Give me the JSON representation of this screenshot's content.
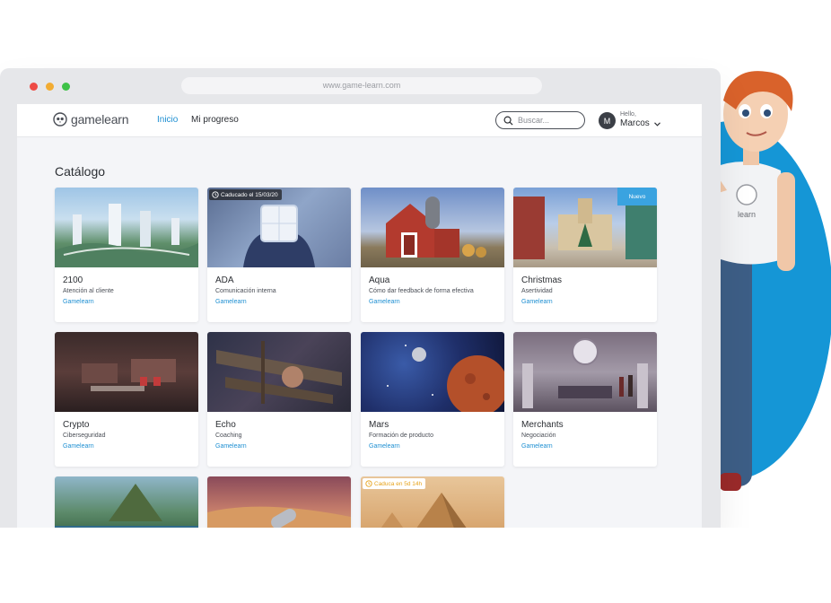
{
  "browser": {
    "url": "www.game-learn.com",
    "colors": {
      "close": "#ee4b45",
      "minimize": "#f2ac33",
      "maximize": "#3ec248"
    }
  },
  "header": {
    "logo_text": "gamelearn",
    "nav": [
      {
        "label": "Inicio",
        "active": true
      },
      {
        "label": "Mi progreso",
        "active": false
      }
    ],
    "search_placeholder": "Buscar...",
    "user": {
      "avatar_initial": "M",
      "greeting": "Hello,",
      "name": "Marcos"
    }
  },
  "catalog": {
    "title": "Catálogo",
    "courses": [
      {
        "title": "2100",
        "subtitle": "Atención al cliente",
        "author": "Gamelearn",
        "thumb": "futuristic-city",
        "badge": null
      },
      {
        "title": "ADA",
        "subtitle": "Comunicación interna",
        "author": "Gamelearn",
        "thumb": "glowing-cube-hands",
        "badge": {
          "type": "expired",
          "text": "Caducado el 15/03/20"
        }
      },
      {
        "title": "Aqua",
        "subtitle": "Cómo dar feedback de forma efectiva",
        "author": "Gamelearn",
        "thumb": "red-barn",
        "badge": null
      },
      {
        "title": "Christmas",
        "subtitle": "Asertividad",
        "author": "Gamelearn",
        "thumb": "christmas-square",
        "badge": {
          "type": "new",
          "text": "Nuevo"
        }
      },
      {
        "title": "Crypto",
        "subtitle": "Ciberseguridad",
        "author": "Gamelearn",
        "thumb": "dark-office",
        "badge": null
      },
      {
        "title": "Echo",
        "subtitle": "Coaching",
        "author": "Gamelearn",
        "thumb": "shipwreck",
        "badge": null
      },
      {
        "title": "Mars",
        "subtitle": "Formación de producto",
        "author": "Gamelearn",
        "thumb": "space-planet",
        "badge": null
      },
      {
        "title": "Merchants",
        "subtitle": "Negociación",
        "author": "Gamelearn",
        "thumb": "cathedral-hall",
        "badge": null
      },
      {
        "title": "",
        "subtitle": "",
        "author": "",
        "thumb": "tropical-island",
        "badge": null
      },
      {
        "title": "",
        "subtitle": "",
        "author": "",
        "thumb": "desert-dunes",
        "badge": null
      },
      {
        "title": "",
        "subtitle": "",
        "author": "",
        "thumb": "pyramids",
        "badge": {
          "type": "expiring",
          "text": "Caduca en 5d 14h"
        }
      }
    ]
  },
  "colors": {
    "accent": "#1e8fd2",
    "brand_blue": "#1596d6",
    "warning": "#e6a21a",
    "new_badge": "#3aa3e0"
  }
}
